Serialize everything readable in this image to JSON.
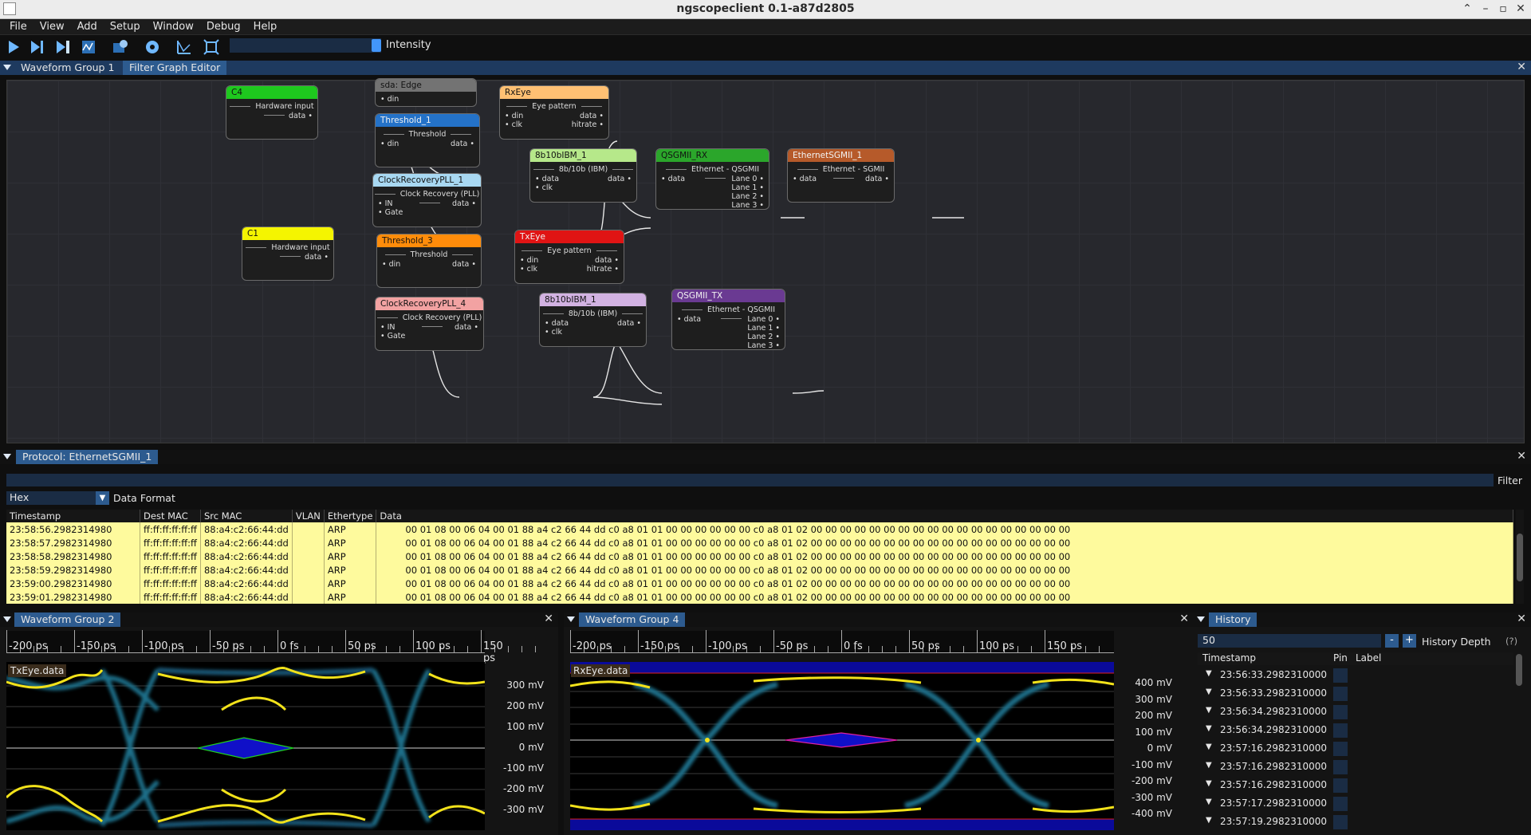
{
  "window": {
    "title": "ngscopeclient 0.1-a87d2805"
  },
  "menu": [
    "File",
    "View",
    "Add",
    "Setup",
    "Window",
    "Debug",
    "Help"
  ],
  "toolbar": {
    "icons": [
      "play-icon",
      "play-once-icon",
      "play-single-icon",
      "stop-icon",
      "scope-icon",
      "settings-icon",
      "measure-icon",
      "autofit-icon"
    ],
    "intensity_label": "Intensity",
    "intensity_value": 0.95
  },
  "top_tabs": {
    "tab1": "Waveform Group 1",
    "tab2": "Filter Graph Editor"
  },
  "graph": {
    "nodes": [
      {
        "id": "c4",
        "title": "C4",
        "kind": "Hardware input",
        "color": "#1ec81e",
        "inputs": [],
        "outputs": [
          "data"
        ]
      },
      {
        "id": "sda",
        "title": "sda: Edge",
        "kind": "",
        "color": "#737373",
        "inputs": [
          "din"
        ],
        "outputs": []
      },
      {
        "id": "thr1",
        "title": "Threshold_1",
        "kind": "Threshold",
        "color": "#2472c8",
        "inputs": [
          "din"
        ],
        "outputs": [
          "data"
        ]
      },
      {
        "id": "rxeye",
        "title": "RxEye",
        "kind": "Eye pattern",
        "color": "#ffc073",
        "inputs": [
          "din",
          "clk"
        ],
        "outputs": [
          "data",
          "hitrate"
        ]
      },
      {
        "id": "crp1",
        "title": "ClockRecoveryPLL_1",
        "kind": "Clock Recovery (PLL)",
        "color": "#a8d8f2",
        "inputs": [
          "IN",
          "Gate"
        ],
        "outputs": [
          "data"
        ]
      },
      {
        "id": "b10a",
        "title": "8b10bIBM_1",
        "kind": "8b/10b (IBM)",
        "color": "#b6e88a",
        "inputs": [
          "data",
          "clk"
        ],
        "outputs": [
          "data"
        ]
      },
      {
        "id": "qrx",
        "title": "QSGMII_RX",
        "kind": "Ethernet - QSGMII",
        "color": "#2ba62b",
        "inputs": [
          "data"
        ],
        "outputs": [
          "Lane 0",
          "Lane 1",
          "Lane 2",
          "Lane 3"
        ]
      },
      {
        "id": "esg",
        "title": "EthernetSGMII_1",
        "kind": "Ethernet - SGMII",
        "color": "#b65a2a",
        "inputs": [
          "data"
        ],
        "outputs": [
          "data"
        ]
      },
      {
        "id": "c1",
        "title": "C1",
        "kind": "Hardware input",
        "color": "#f5f500",
        "inputs": [],
        "outputs": [
          "data"
        ]
      },
      {
        "id": "thr3",
        "title": "Threshold_3",
        "kind": "Threshold",
        "color": "#ff8c0a",
        "inputs": [
          "din"
        ],
        "outputs": [
          "data"
        ]
      },
      {
        "id": "txeye",
        "title": "TxEye",
        "kind": "Eye pattern",
        "color": "#e01414",
        "inputs": [
          "din",
          "clk"
        ],
        "outputs": [
          "data",
          "hitrate"
        ]
      },
      {
        "id": "crp4",
        "title": "ClockRecoveryPLL_4",
        "kind": "Clock Recovery (PLL)",
        "color": "#f2a2a2",
        "inputs": [
          "IN",
          "Gate"
        ],
        "outputs": [
          "data"
        ]
      },
      {
        "id": "b10b",
        "title": "8b10bIBM_1",
        "kind": "8b/10b (IBM)",
        "color": "#d2b2e2",
        "inputs": [
          "data",
          "clk"
        ],
        "outputs": [
          "data"
        ]
      },
      {
        "id": "qtx",
        "title": "QSGMII_TX",
        "kind": "Ethernet - QSGMII",
        "color": "#6a3a92",
        "inputs": [
          "data"
        ],
        "outputs": [
          "Lane 0",
          "Lane 1",
          "Lane 2",
          "Lane 3"
        ]
      }
    ]
  },
  "protocol": {
    "tab": "Protocol: EthernetSGMII_1",
    "filter_label": "Filter",
    "format_value": "Hex",
    "format_label": "Data Format",
    "columns": [
      "Timestamp",
      "Dest MAC",
      "Src MAC",
      "VLAN",
      "Ethertype",
      "Data"
    ],
    "rows": [
      [
        "23:58:56.2982314980",
        "ff:ff:ff:ff:ff:ff",
        "88:a4:c2:66:44:dd",
        "",
        "ARP",
        "00 01 08 00 06 04 00 01 88 a4 c2 66 44 dd c0 a8 01 01 00 00 00 00 00 00 c0 a8 01 02 00 00 00 00 00 00 00 00 00 00 00 00 00 00 00 00 00 00"
      ],
      [
        "23:58:57.2982314980",
        "ff:ff:ff:ff:ff:ff",
        "88:a4:c2:66:44:dd",
        "",
        "ARP",
        "00 01 08 00 06 04 00 01 88 a4 c2 66 44 dd c0 a8 01 01 00 00 00 00 00 00 c0 a8 01 02 00 00 00 00 00 00 00 00 00 00 00 00 00 00 00 00 00 00"
      ],
      [
        "23:58:58.2982314980",
        "ff:ff:ff:ff:ff:ff",
        "88:a4:c2:66:44:dd",
        "",
        "ARP",
        "00 01 08 00 06 04 00 01 88 a4 c2 66 44 dd c0 a8 01 01 00 00 00 00 00 00 c0 a8 01 02 00 00 00 00 00 00 00 00 00 00 00 00 00 00 00 00 00 00"
      ],
      [
        "23:58:59.2982314980",
        "ff:ff:ff:ff:ff:ff",
        "88:a4:c2:66:44:dd",
        "",
        "ARP",
        "00 01 08 00 06 04 00 01 88 a4 c2 66 44 dd c0 a8 01 01 00 00 00 00 00 00 c0 a8 01 02 00 00 00 00 00 00 00 00 00 00 00 00 00 00 00 00 00 00"
      ],
      [
        "23:59:00.2982314980",
        "ff:ff:ff:ff:ff:ff",
        "88:a4:c2:66:44:dd",
        "",
        "ARP",
        "00 01 08 00 06 04 00 01 88 a4 c2 66 44 dd c0 a8 01 01 00 00 00 00 00 00 c0 a8 01 02 00 00 00 00 00 00 00 00 00 00 00 00 00 00 00 00 00 00"
      ],
      [
        "23:59:01.2982314980",
        "ff:ff:ff:ff:ff:ff",
        "88:a4:c2:66:44:dd",
        "",
        "ARP",
        "00 01 08 00 06 04 00 01 88 a4 c2 66 44 dd c0 a8 01 01 00 00 00 00 00 00 c0 a8 01 02 00 00 00 00 00 00 00 00 00 00 00 00 00 00 00 00 00 00"
      ]
    ]
  },
  "wg2": {
    "tab": "Waveform Group 2",
    "ticks": [
      "-200 ps",
      "-150 ps",
      "-100 ps",
      "-50 ps",
      "0 fs",
      "50 ps",
      "100 ps",
      "150 ps"
    ],
    "channel": "TxEye.data",
    "channel_color": "#ff3a3a",
    "yticks": [
      "300 mV",
      "200 mV",
      "100 mV",
      "0 mV",
      "-100 mV",
      "-200 mV",
      "-300 mV"
    ]
  },
  "wg4": {
    "tab": "Waveform Group 4",
    "ticks": [
      "-200 ps",
      "-150 ps",
      "-100 ps",
      "-50 ps",
      "0 fs",
      "50 ps",
      "100 ps",
      "150 ps"
    ],
    "channel": "RxEye.data",
    "channel_color": "#ffc073",
    "yticks": [
      "400 mV",
      "300 mV",
      "200 mV",
      "100 mV",
      "0 mV",
      "-100 mV",
      "-200 mV",
      "-300 mV",
      "-400 mV"
    ]
  },
  "history": {
    "tab": "History",
    "depth_value": "50",
    "minus": "-",
    "plus": "+",
    "depth_label": "History Depth",
    "help": "(?)",
    "columns": [
      "Timestamp",
      "Pin",
      "Label"
    ],
    "rows": [
      "23:56:33.2982310000",
      "23:56:33.2982310000",
      "23:56:34.2982310000",
      "23:56:34.2982310000",
      "23:57:16.2982310000",
      "23:57:16.2982310000",
      "23:57:16.2982310000",
      "23:57:17.2982310000",
      "23:57:19.2982310000"
    ]
  }
}
